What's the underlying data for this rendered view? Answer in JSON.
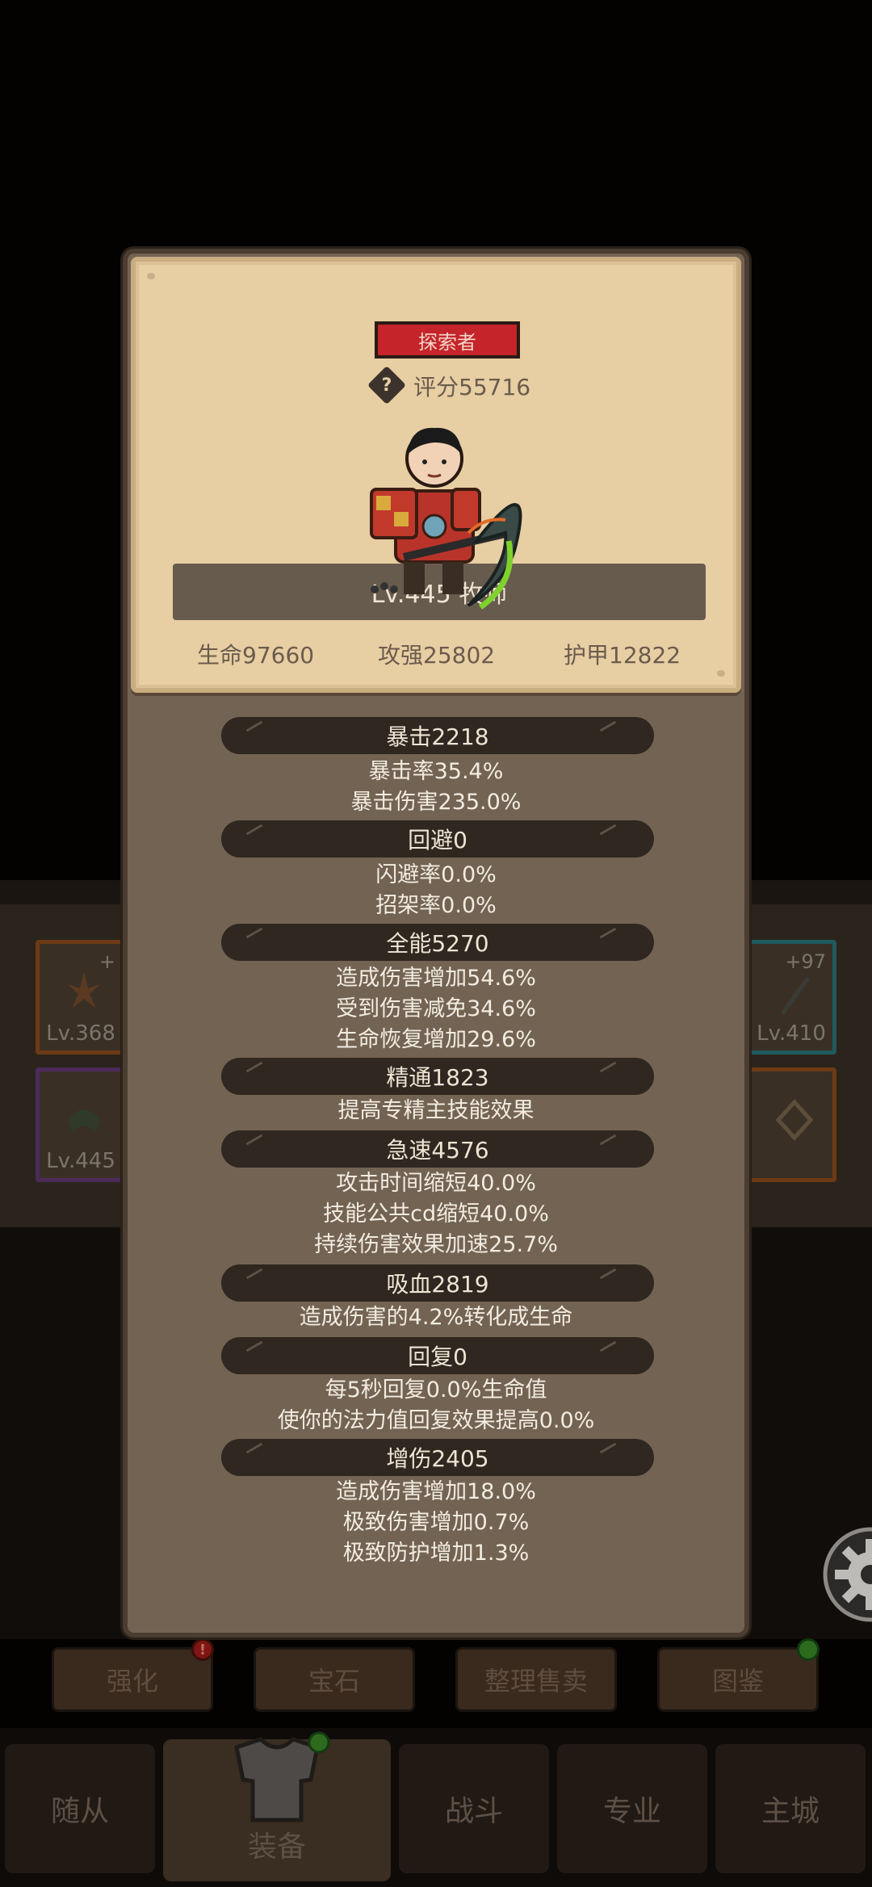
{
  "background": {
    "left_slots": [
      {
        "level": "Lv.368",
        "plus": "+"
      },
      {
        "level": "Lv.445",
        "plus": ""
      }
    ],
    "right_slots": [
      {
        "level": "Lv.410",
        "plus": "+97"
      },
      {
        "level": "",
        "plus": ""
      }
    ],
    "function_buttons": [
      {
        "label": "强化",
        "badge": "!"
      },
      {
        "label": "宝石",
        "badge": ""
      },
      {
        "label": "整理售卖",
        "badge": ""
      },
      {
        "label": "图鉴",
        "badge": "green"
      }
    ],
    "nav_tabs": [
      {
        "label": "随从"
      },
      {
        "label": "装备"
      },
      {
        "label": "战斗"
      },
      {
        "label": "专业"
      },
      {
        "label": "主城"
      }
    ]
  },
  "profile": {
    "title": "探索者",
    "help_icon": "?",
    "score": "评分55716",
    "level_class": "Lv.445 牧师",
    "stats": {
      "hp": "生命97660",
      "attack": "攻强25802",
      "armor": "护甲12822"
    }
  },
  "attributes": [
    {
      "header": "暴击2218",
      "lines": [
        "暴击率35.4%",
        "暴击伤害235.0%"
      ]
    },
    {
      "header": "回避0",
      "lines": [
        "闪避率0.0%",
        "招架率0.0%"
      ]
    },
    {
      "header": "全能5270",
      "lines": [
        "造成伤害增加54.6%",
        "受到伤害减免34.6%",
        "生命恢复增加29.6%"
      ]
    },
    {
      "header": "精通1823",
      "lines": [
        "提高专精主技能效果"
      ]
    },
    {
      "header": "急速4576",
      "lines": [
        "攻击时间缩短40.0%",
        "技能公共cd缩短40.0%",
        "持续伤害效果加速25.7%"
      ]
    },
    {
      "header": "吸血2819",
      "lines": [
        "造成伤害的4.2%转化成生命"
      ]
    },
    {
      "header": "回复0",
      "lines": [
        "每5秒回复0.0%生命值",
        "使你的法力值回复效果提高0.0%"
      ]
    },
    {
      "header": "增伤2405",
      "lines": [
        "造成伤害增加18.0%",
        "极致伤害增加0.7%",
        "极致防护增加1.3%"
      ]
    }
  ],
  "colors": {
    "parchment": "#e7cea3",
    "title_red": "#c4242a",
    "modal_brown": "#736353",
    "header_dark": "#2f2720"
  }
}
